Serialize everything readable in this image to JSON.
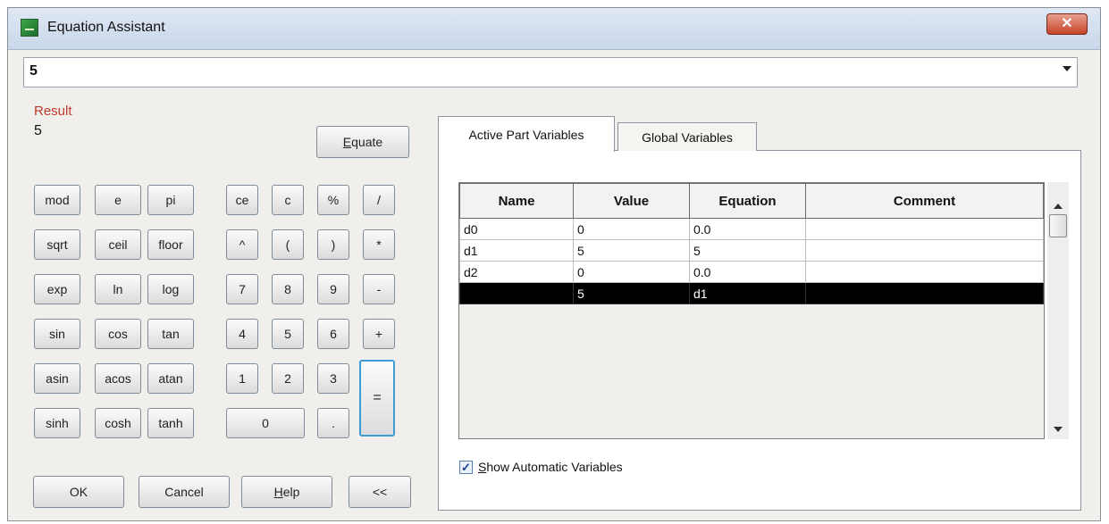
{
  "window": {
    "title": "Equation Assistant",
    "close_glyph": "✕"
  },
  "equation_input": {
    "value": "5"
  },
  "result": {
    "label": "Result",
    "value": "5"
  },
  "equate_button": {
    "accesskey": "E",
    "rest": "quate"
  },
  "keypad": {
    "functions": [
      "mod",
      "e",
      "pi",
      "sqrt",
      "ceil",
      "floor",
      "exp",
      "ln",
      "log",
      "sin",
      "cos",
      "tan",
      "asin",
      "acos",
      "atan",
      "sinh",
      "cosh",
      "tanh"
    ],
    "operators": [
      "ce",
      "c",
      "%",
      "/",
      "^",
      "(",
      ")",
      "*",
      "7",
      "8",
      "9",
      "-",
      "4",
      "5",
      "6",
      "+",
      "1",
      "2",
      "3"
    ],
    "zero": "0",
    "dot": ".",
    "equals": "="
  },
  "buttons": {
    "ok": "OK",
    "cancel": "Cancel",
    "help_accesskey": "H",
    "help_rest": "elp",
    "toggle": "<<"
  },
  "tabs": [
    {
      "label": "Active Part Variables",
      "active": true
    },
    {
      "label": "Global Variables",
      "active": false
    }
  ],
  "variables_table": {
    "columns": [
      "Name",
      "Value",
      "Equation",
      "Comment"
    ],
    "rows": [
      {
        "name": "d0",
        "value": "0",
        "equation": "0.0",
        "comment": "",
        "selected": false
      },
      {
        "name": "d1",
        "value": "5",
        "equation": "5",
        "comment": "",
        "selected": false
      },
      {
        "name": "d2",
        "value": "0",
        "equation": "0.0",
        "comment": "",
        "selected": false
      },
      {
        "name": "",
        "value": "5",
        "equation": "d1",
        "comment": "",
        "selected": true
      }
    ]
  },
  "show_automatic": {
    "checked": true,
    "check_glyph": "✓",
    "accesskey": "S",
    "rest": "how Automatic Variables"
  }
}
